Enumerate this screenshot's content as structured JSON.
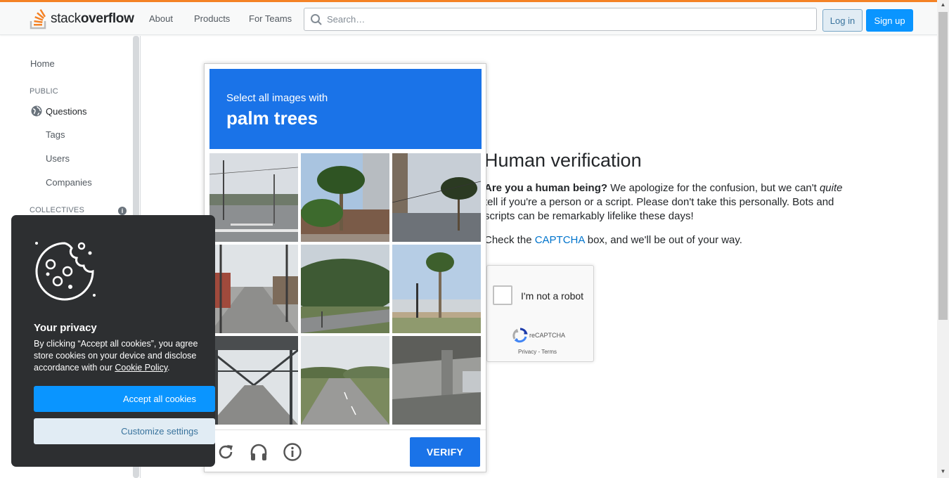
{
  "header": {
    "logo_text_prefix": "stack",
    "logo_text_bold": "overflow",
    "nav": [
      "About",
      "Products",
      "For Teams"
    ],
    "search_placeholder": "Search…",
    "login_label": "Log in",
    "signup_label": "Sign up",
    "accent_color": "#f48225"
  },
  "sidebar": {
    "home": "Home",
    "public_heading": "PUBLIC",
    "items": [
      "Questions",
      "Tags",
      "Users",
      "Companies"
    ],
    "collectives_heading": "COLLECTIVES"
  },
  "verification": {
    "title": "Human verification",
    "para1_bold": "Are you a human being?",
    "para1_rest_a": " We apologize for the confusion, but we can't ",
    "para1_italic": "quite",
    "para1_rest_b": " tell if you're a person or a script. Please don't take this personally. Bots and scripts can be remarkably lifelike these days!",
    "para2_a": "Check the ",
    "para2_link": "CAPTCHA",
    "para2_b": " box, and we'll be out of your way.",
    "checkbox_label": "I'm not a robot",
    "brand": "reCAPTCHA",
    "privacy_link": "Privacy",
    "terms_link": "Terms"
  },
  "challenge": {
    "instruction": "Select all images with",
    "target": "palm trees",
    "tiles": [
      "street-intersection",
      "palm-trees-building",
      "palm-tree-street",
      "city-street",
      "road-trees",
      "palm-tree-intersection",
      "steel-bridge",
      "highway",
      "overpass"
    ],
    "verify_label": "VERIFY",
    "icons": [
      "reload-icon",
      "audio-icon",
      "info-icon"
    ],
    "header_color": "#1a73e8"
  },
  "privacy": {
    "title": "Your privacy",
    "text": "By clicking “Accept all cookies”, you agree\nstore cookies on your device and disclose\naccordance with our ",
    "policy_link": "Cookie Policy",
    "text_end": ".",
    "accept_label": "Accept all cookies",
    "customize_label": "Customize settings"
  }
}
